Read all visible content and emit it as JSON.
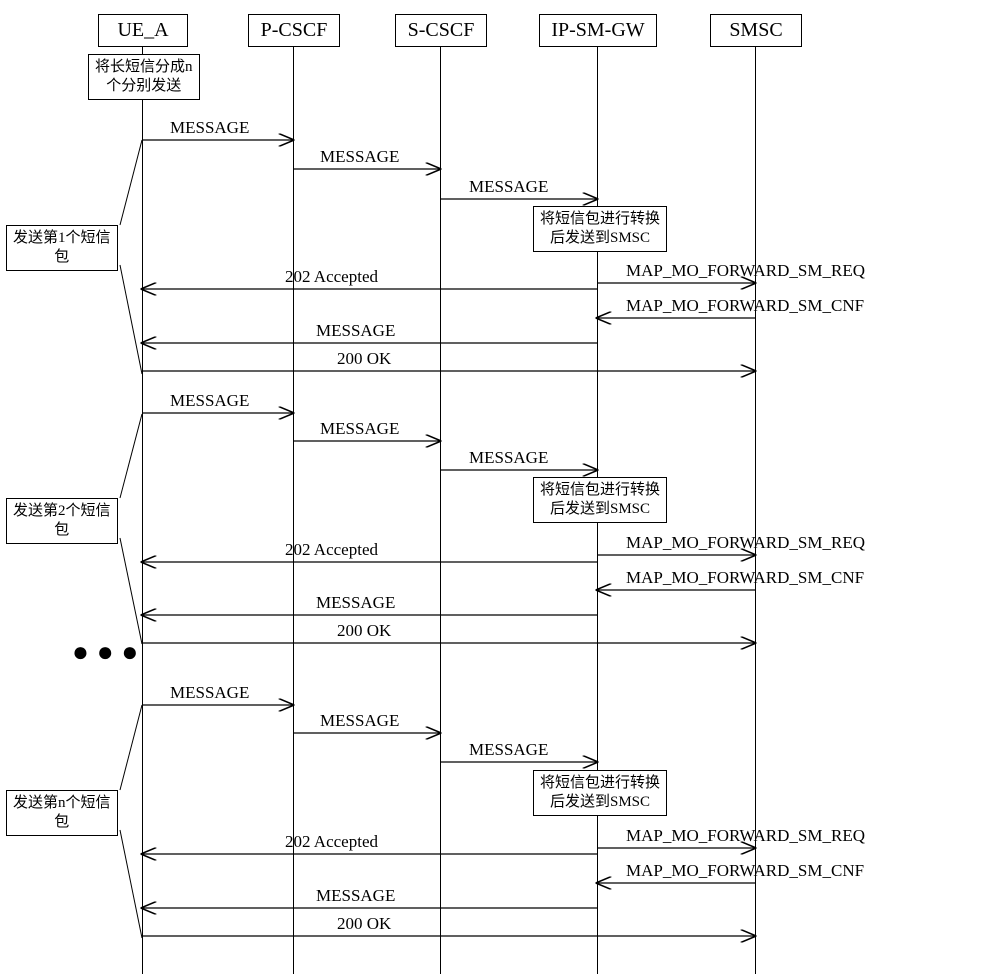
{
  "actors": {
    "ue_a": "UE_A",
    "pcscf": "P-CSCF",
    "scscf": "S-CSCF",
    "ipsmgw": "IP-SM-GW",
    "smsc": "SMSC"
  },
  "notes": {
    "split": "将长短信分成n\n个分别发送",
    "pkt1": "发送第1个短信\n包",
    "pkt2": "发送第2个短信\n包",
    "pktn": "发送第n个短信\n包",
    "conv": "将短信包进行转换\n后发送到SMSC"
  },
  "messages": {
    "msg": "MESSAGE",
    "accepted": "202 Accepted",
    "ok": "200 OK",
    "req": "MAP_MO_FORWARD_SM_REQ",
    "cnf": "MAP_MO_FORWARD_SM_CNF"
  },
  "ellipsis": "● ● ●"
}
